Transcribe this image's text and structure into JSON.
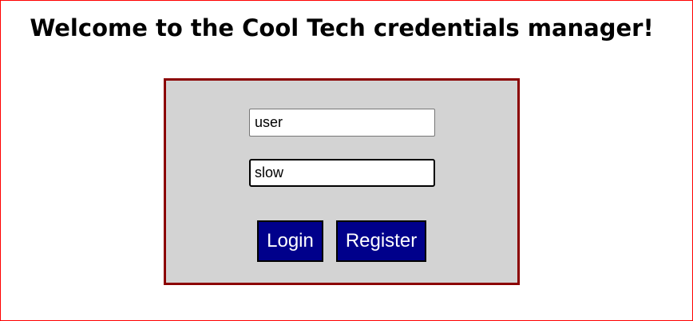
{
  "page": {
    "title": "Welcome to the Cool Tech credentials manager!"
  },
  "form": {
    "username_value": "user",
    "password_value": "slow",
    "login_label": "Login",
    "register_label": "Register"
  },
  "colors": {
    "panel_border": "#8b0000",
    "panel_bg": "#d3d3d3",
    "button_bg": "#00008b"
  }
}
